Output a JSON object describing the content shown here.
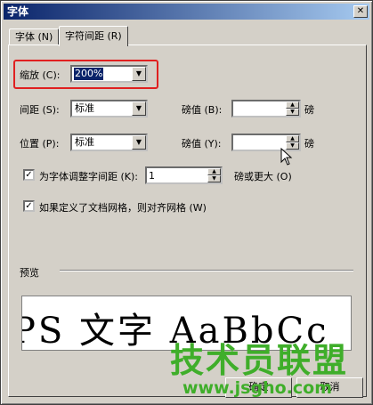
{
  "window": {
    "title": "字体",
    "close_glyph": "✕"
  },
  "tabs": [
    {
      "label": "字体 (N)",
      "active": false
    },
    {
      "label": "字符间距 (R)",
      "active": true
    }
  ],
  "scale": {
    "label": "缩放 (C):",
    "value": "200%"
  },
  "spacing": {
    "label": "间距 (S):",
    "value": "标准",
    "by_label": "磅值 (B):",
    "by_value": "",
    "unit": "磅"
  },
  "position": {
    "label": "位置 (P):",
    "value": "标准",
    "by_label": "磅值 (Y):",
    "by_value": "",
    "unit": "磅"
  },
  "kerning": {
    "checked": true,
    "label": "为字体调整字间距 (K):",
    "value": "1",
    "suffix": "磅或更大 (O)"
  },
  "grid": {
    "checked": true,
    "label": "如果定义了文档网格，则对齐网格 (W)"
  },
  "preview": {
    "label": "预览",
    "sample": "PS 文字 AaBbCc"
  },
  "buttons": {
    "ok": "确定",
    "cancel": "取消"
  },
  "watermark": {
    "main": "技术员联盟",
    "sub": "www.jsgho.com"
  },
  "accent_colors": {
    "title_bar": "#0a246a",
    "highlight_box": "#e02020",
    "watermark": "#3fae2a"
  }
}
